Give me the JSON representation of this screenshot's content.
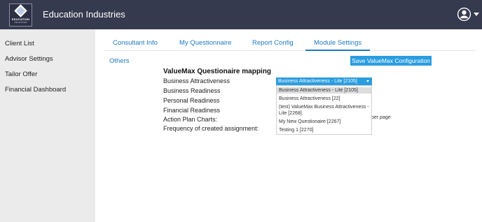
{
  "header": {
    "logo_text": "EDUCATION",
    "logo_sub": "INDUSTRIES",
    "title": "Education Industries"
  },
  "sidebar": {
    "items": [
      {
        "label": "Client List"
      },
      {
        "label": "Advisor Settings"
      },
      {
        "label": "Tailor Offer"
      },
      {
        "label": "Financial Dashboard"
      }
    ]
  },
  "tabs": [
    {
      "label": "Consultant Info"
    },
    {
      "label": "My Questionnaire"
    },
    {
      "label": "Report Config"
    },
    {
      "label": "Module Settings",
      "active": true
    }
  ],
  "subtab": "Others",
  "save_button": "Save ValueMax Configuration",
  "section_title": "ValueMax Questionaire mapping",
  "rows": [
    {
      "label": "Business Attractiveness"
    },
    {
      "label": "Business Readiness"
    },
    {
      "label": "Personal Readiness"
    },
    {
      "label": "Financial Readiness"
    },
    {
      "label": "Action Plan Charts:"
    },
    {
      "label": "Frequency of created assignment:"
    }
  ],
  "select": {
    "value": "Business Attractiveness - Lite [2105]",
    "options": [
      {
        "label": "Business Attractiveness - Lite [2105]",
        "selected": true
      },
      {
        "label": "Business Attractiveness [22]"
      },
      {
        "label": "(test) ValueMax Business Attractiveness - Lite [2268]"
      },
      {
        "label": "My New Questionaire [2267]"
      },
      {
        "label": "Testing 1 [2270]"
      }
    ]
  },
  "partial_text": "per page"
}
